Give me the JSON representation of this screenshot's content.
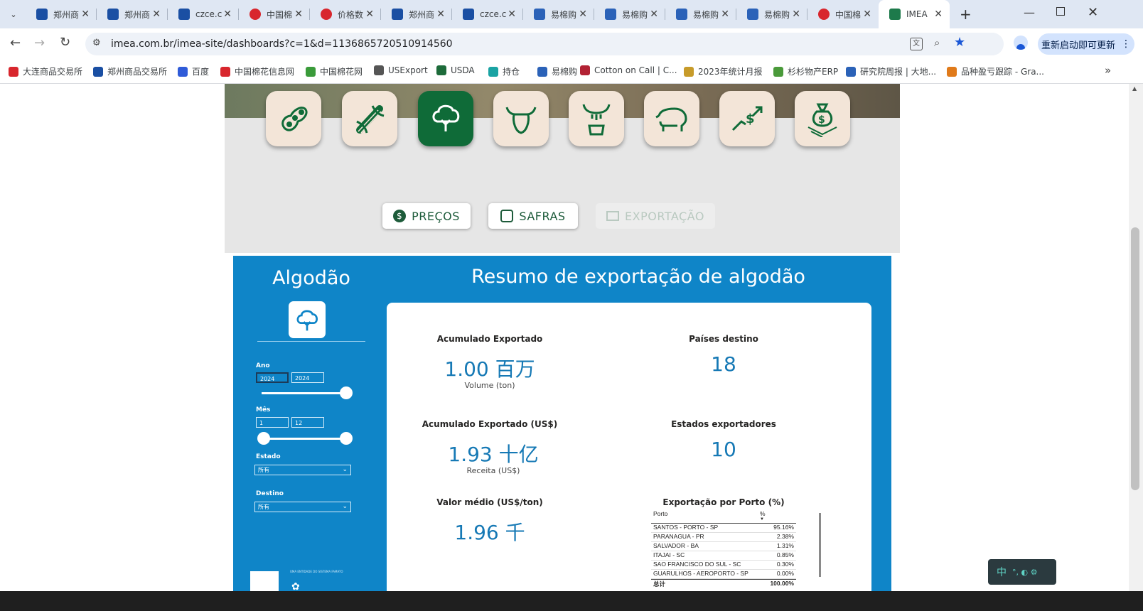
{
  "tabs": [
    {
      "label": "郑州商",
      "favicon": "zz"
    },
    {
      "label": "郑州商",
      "favicon": "zz"
    },
    {
      "label": "czce.c",
      "favicon": "zz"
    },
    {
      "label": "中国棉",
      "favicon": "cotton"
    },
    {
      "label": "价格数",
      "favicon": "cotton"
    },
    {
      "label": "郑州商",
      "favicon": "zz"
    },
    {
      "label": "czce.c",
      "favicon": "zz"
    },
    {
      "label": "易棉购",
      "favicon": "yi"
    },
    {
      "label": "易棉购",
      "favicon": "yi"
    },
    {
      "label": "易棉购",
      "favicon": "yi"
    },
    {
      "label": "易棉购",
      "favicon": "yi"
    },
    {
      "label": "中国棉",
      "favicon": "cotton"
    },
    {
      "label": "IMEA",
      "favicon": "imea",
      "active": true
    }
  ],
  "toolbar": {
    "url": "imea.com.br/imea-site/dashboards?c=1&d=1136865720510914560",
    "update_label": "重新启动即可更新"
  },
  "bookmarks": [
    {
      "label": "大连商品交易所",
      "color": "#d8262d"
    },
    {
      "label": "郑州商品交易所",
      "color": "#1a4fa3"
    },
    {
      "label": "百度",
      "color": "#2f5bd8"
    },
    {
      "label": "中国棉花信息网",
      "color": "#d8262d"
    },
    {
      "label": "中国棉花网",
      "color": "#3a9b3a"
    },
    {
      "label": "USExport",
      "color": "#555555"
    },
    {
      "label": "USDA",
      "color": "#1d6b3a"
    },
    {
      "label": "持仓",
      "color": "#1aa3a3"
    },
    {
      "label": "易棉购",
      "color": "#2b62b8"
    },
    {
      "label": "Cotton on Call | C...",
      "color": "#b22234"
    },
    {
      "label": "2023年统计月报",
      "color": "#c79b2a"
    },
    {
      "label": "杉杉物产ERP",
      "color": "#4a9a3a"
    },
    {
      "label": "研究院周报 | 大地...",
      "color": "#2b62b8"
    },
    {
      "label": "品种盈亏跟踪 - Gra...",
      "color": "#e07a1a"
    }
  ],
  "categories": [
    "soja",
    "milho",
    "algodao",
    "boi",
    "leite",
    "suinos",
    "economia",
    "custos"
  ],
  "nav_tabs": [
    "PREÇOS",
    "SAFRAS",
    "EXPORTAÇÃO"
  ],
  "dashboard": {
    "left_title": "Algodão",
    "main_title": "Resumo de exportação de algodão",
    "filters": {
      "ano_label": "Ano",
      "ano_from": "2024",
      "ano_to": "2024",
      "mes_label": "Mês",
      "mes_from": "1",
      "mes_to": "12",
      "estado_label": "Estado",
      "estado_value": "所有",
      "destino_label": "Destino",
      "destino_value": "所有"
    },
    "kpis": {
      "acum_label": "Acumulado Exportado",
      "acum_value": "1.00 百万",
      "acum_sub": "Volume (ton)",
      "paises_label": "Países destino",
      "paises_value": "18",
      "acum_usd_label": "Acumulado Exportado (US$)",
      "acum_usd_value": "1.93 十亿",
      "acum_usd_sub": "Receita (US$)",
      "estados_label": "Estados exportadores",
      "estados_value": "10",
      "medio_label": "Valor médio (US$/ton)",
      "medio_value": "1.96 千",
      "porto_label": "Exportação por Porto (%)"
    },
    "port_table": {
      "col_port": "Porto",
      "col_pct": "%",
      "rows": [
        {
          "port": "SANTOS - PORTO - SP",
          "pct": "95.16%"
        },
        {
          "port": "PARANAGUA - PR",
          "pct": "2.38%"
        },
        {
          "port": "SALVADOR - BA",
          "pct": "1.31%"
        },
        {
          "port": "ITAJAI - SC",
          "pct": "0.85%"
        },
        {
          "port": "SAO FRANCISCO DO SUL - SC",
          "pct": "0.30%"
        },
        {
          "port": "GUARULHOS - AEROPORTO - SP",
          "pct": "0.00%"
        }
      ],
      "total_label": "总计",
      "total_value": "100.00%"
    },
    "footer_text": "UMA ENTIDADE DO SISTEMA FAMATO"
  },
  "ime": {
    "label": "中"
  }
}
